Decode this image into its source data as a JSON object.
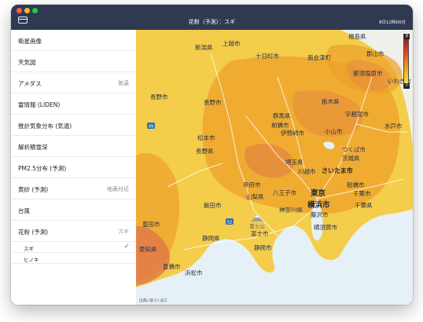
{
  "window": {
    "title": "花粉（予測）：スギ",
    "timestamp": "8日12時00分"
  },
  "sidebar": {
    "items": [
      {
        "label": "衛星画像",
        "value": ""
      },
      {
        "label": "天気図",
        "value": ""
      },
      {
        "label": "アメダス",
        "value": "気温"
      },
      {
        "label": "雷情報 (LIDEN)",
        "value": ""
      },
      {
        "label": "推計気象分布 (気温)",
        "value": ""
      },
      {
        "label": "解析積雪深",
        "value": ""
      },
      {
        "label": "PM2.5分布 (予測)",
        "value": ""
      },
      {
        "label": "黄砂 (予測)",
        "value": "地表付近"
      },
      {
        "label": "台風",
        "value": ""
      },
      {
        "label": "花粉 (予測)",
        "value": "スギ"
      }
    ],
    "subitems": [
      {
        "label": "スギ",
        "checked": true
      },
      {
        "label": "ヒノキ",
        "checked": false
      }
    ]
  },
  "map": {
    "labels": {
      "fukushima_ken": "福島県",
      "niigata_ken": "新潟県",
      "joetsu": "上越市",
      "tokamachi": "十日町市",
      "minamiaizu": "南会津町",
      "koriyama": "郡山市",
      "iwaki": "いわき市",
      "nagano": "長野市",
      "nasushiobara": "那須塩原市",
      "gunma_ken": "群馬県",
      "tochigi_ken": "栃木県",
      "utsunomiya": "宇都宮市",
      "maebashi": "前橋市",
      "isesaki": "伊勢崎市",
      "oyama": "小山市",
      "mito": "水戸市",
      "matsumoto": "松本市",
      "nagano_ken": "長野県",
      "tsukuba": "つくば市",
      "ibaraki_ken": "茨城県",
      "saitama_ken": "埼玉県",
      "kawagoe": "川越市",
      "saitama": "さいたま市",
      "kofu": "甲府市",
      "yamanashi_ken": "山梨県",
      "hachioji": "八王子市",
      "tokyo": "東京",
      "funabashi": "船橋市",
      "chiba": "千葉市",
      "chiba_ken": "千葉県",
      "kanagawa_ken": "神奈川県",
      "yokohama": "横浜市",
      "fujisawa": "藤沢市",
      "yokosuka": "横須賀市",
      "iida": "飯田市",
      "fuji": "富士市",
      "shizuoka_ken": "静岡県",
      "shizuoka": "静岡市",
      "hamamatsu": "浜松市",
      "toyohashi": "豊橋市",
      "aichi_ken": "愛知県",
      "toyota": "豊田市"
    },
    "road_shields": [
      "49",
      "52"
    ],
    "mountain": "富士山",
    "credit": "出典に基づく加工"
  },
  "legend": {
    "high": "多",
    "low": "少"
  },
  "colors": {
    "titlebar": "#2f3a52",
    "pollen_low": "#f5cc2a",
    "pollen_mid": "#f0a72a",
    "pollen_high": "#e0794a",
    "sea": "#e6f0f7",
    "land": "#eef0ea",
    "check": "#2e8bf0"
  }
}
